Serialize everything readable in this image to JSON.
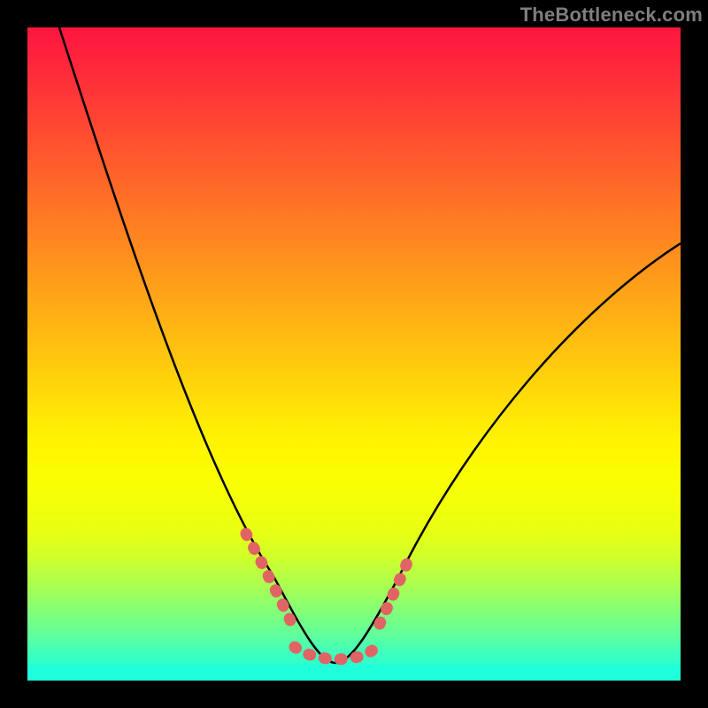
{
  "watermark": "TheBottleneck.com",
  "chart_data": {
    "type": "line",
    "title": "",
    "xlabel": "",
    "ylabel": "",
    "xlim": [
      0,
      100
    ],
    "ylim": [
      0,
      100
    ],
    "series": [
      {
        "name": "curve",
        "x": [
          5,
          10,
          15,
          20,
          25,
          30,
          35,
          40,
          42,
          44,
          46,
          48,
          50,
          55,
          60,
          65,
          70,
          75,
          80,
          85,
          90,
          95,
          100
        ],
        "y": [
          100,
          82,
          66,
          52,
          40,
          29,
          20,
          11,
          8,
          5,
          3,
          2.5,
          3,
          7,
          14,
          23,
          32,
          41,
          49,
          56,
          62,
          67,
          71
        ]
      },
      {
        "name": "highlight-left",
        "x": [
          33.5,
          35,
          37,
          39,
          40.5
        ],
        "y": [
          22.5,
          19.5,
          15.5,
          11,
          8.5
        ]
      },
      {
        "name": "highlight-bottom",
        "x": [
          41,
          43,
          45,
          47,
          49,
          51,
          53
        ],
        "y": [
          4.5,
          3.5,
          3,
          3,
          3.5,
          4.5,
          6
        ]
      },
      {
        "name": "highlight-right",
        "x": [
          54,
          55.5,
          57,
          58.5
        ],
        "y": [
          9,
          12,
          15.5,
          19
        ]
      }
    ],
    "background_gradient": {
      "top": "#ff153f",
      "mid": "#fff302",
      "bottom": "#19ffe2"
    }
  }
}
